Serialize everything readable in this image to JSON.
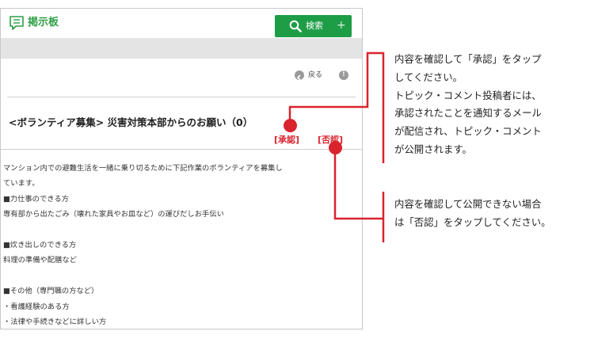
{
  "app": {
    "title": "掲示板",
    "search_label": "検索",
    "search_plus": "+",
    "back_label": "戻る",
    "more_glyph": "⋮"
  },
  "post": {
    "title": "<ボランティア募集> 災害対策本部からのお願い（0）",
    "approve_label": "[承認]",
    "reject_label": "[否認]",
    "body_lines": [
      "マンション内での避難生活を一緒に乗り切るために下記作業のボランティアを募集し",
      "ています。",
      "■力仕事のできる方",
      "専有部から出たごみ（壊れた家具やお皿など）の運びだしお手伝い",
      "",
      "■炊き出しのできる方",
      "料理の準備や配膳など",
      "",
      "■その他（専門職の方など）",
      "・看護経験のある方",
      "・法律や手続きなどに詳しい方"
    ]
  },
  "annotations": {
    "approve_note_lines": [
      "内容を確認して「承認」をタップ",
      "してください。",
      "トピック・コメント投稿者には、",
      "承認されたことを通知するメール",
      "が配信され、トピック・コメント",
      "が公開されます。"
    ],
    "reject_note_lines": [
      "内容を確認して公開できない場合",
      "は「否認」をタップしてください。"
    ]
  },
  "colors": {
    "brand_green": "#1e9d47",
    "title_green": "#2f9e46",
    "callout_red": "#d9232d"
  },
  "icons": {
    "board": "bulletin-board-icon",
    "search": "search-icon",
    "back": "back-arrow-icon",
    "more": "more-icon"
  }
}
